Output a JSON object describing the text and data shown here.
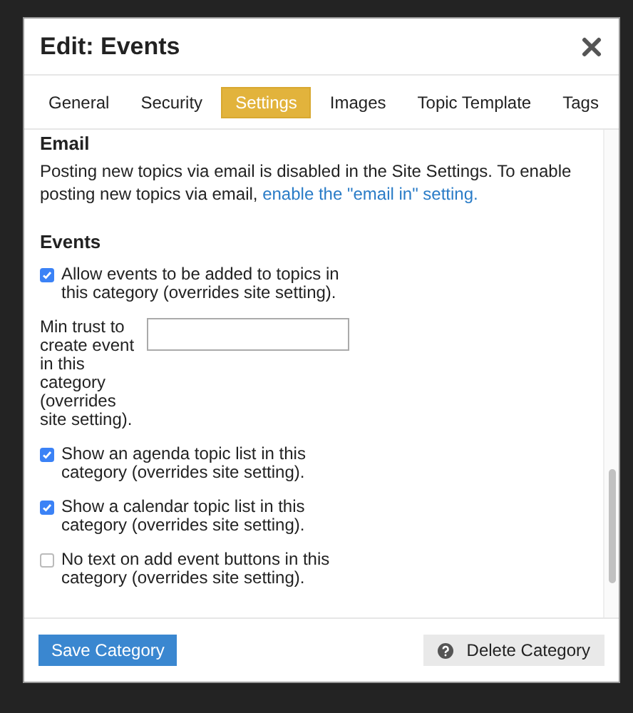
{
  "dialog": {
    "title": "Edit: Events"
  },
  "tabs": [
    {
      "label": "General",
      "selected": false
    },
    {
      "label": "Security",
      "selected": false
    },
    {
      "label": "Settings",
      "selected": true
    },
    {
      "label": "Images",
      "selected": false
    },
    {
      "label": "Topic Template",
      "selected": false
    },
    {
      "label": "Tags",
      "selected": false
    }
  ],
  "email": {
    "heading": "Email",
    "text": "Posting new topics via email is disabled in the Site Settings. To enable posting new topics via email,",
    "link": "enable the \"email in\" setting."
  },
  "events": {
    "heading": "Events",
    "items": [
      {
        "kind": "checkbox",
        "label": "Allow events to be added to topics in this category (overrides site setting).",
        "checked": true
      },
      {
        "kind": "field",
        "label": "Min trust to create event in this category (overrides site setting)."
      },
      {
        "kind": "checkbox",
        "label": "Show an agenda topic list in this category (overrides site setting).",
        "checked": true
      },
      {
        "kind": "checkbox",
        "label": "Show a calendar topic list in this category (overrides site setting).",
        "checked": true
      },
      {
        "kind": "checkbox",
        "label": "No text on add event buttons in this category (overrides site setting).",
        "checked": false
      }
    ]
  },
  "footer": {
    "save": "Save Category",
    "delete": "Delete Category"
  }
}
